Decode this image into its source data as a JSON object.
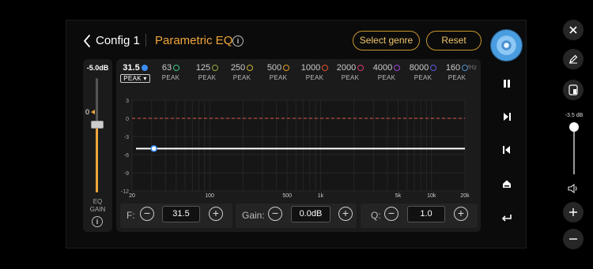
{
  "header": {
    "config_label": "Config 1",
    "title": "Parametric EQ",
    "info": "i",
    "select_genre_label": "Select genre",
    "reset_label": "Reset"
  },
  "eq_gain": {
    "value": "-5.0dB",
    "slider_marker": "0",
    "label_line1": "EQ",
    "label_line2": "GAIN",
    "info": "i"
  },
  "bands": [
    {
      "freq": "31.5",
      "type": "PEAK ▾",
      "color": "#3b8cf2",
      "active": true
    },
    {
      "freq": "63",
      "type": "PEAK",
      "color": "#3dc48a"
    },
    {
      "freq": "125",
      "type": "PEAK",
      "color": "#9aa83a"
    },
    {
      "freq": "250",
      "type": "PEAK",
      "color": "#c9b234"
    },
    {
      "freq": "500",
      "type": "PEAK",
      "color": "#e09a2b"
    },
    {
      "freq": "1000",
      "type": "PEAK",
      "color": "#e0552b"
    },
    {
      "freq": "2000",
      "type": "PEAK",
      "color": "#d63b6a"
    },
    {
      "freq": "4000",
      "type": "PEAK",
      "color": "#9a4ad6"
    },
    {
      "freq": "8000",
      "type": "PEAK",
      "color": "#5b5be0"
    },
    {
      "freq": "160",
      "type": "PEAK",
      "color": "#4a8fd0"
    }
  ],
  "hz_unit": "/Hz",
  "graph": {
    "y_ticks": [
      "3",
      "0",
      "-3",
      "-6",
      "-9",
      "-12"
    ],
    "x_ticks": [
      "20",
      "100",
      "500",
      "1k",
      "5k",
      "10k",
      "20k"
    ],
    "curve_gain_db": -5.0,
    "reference_line_db": 0,
    "control_point": {
      "freq": 31.5,
      "gain_db": -5.0
    }
  },
  "controls": {
    "f_label": "F:",
    "f_value": "31.5",
    "gain_label": "Gain:",
    "gain_value": "0.0dB",
    "q_label": "Q:",
    "q_value": "1.0",
    "minus": "−",
    "plus": "+"
  },
  "system": {
    "volume_label": "-3.5 dB",
    "volume_level": 0.0
  },
  "colors": {
    "accent": "#f0a63a",
    "active_band": "#3b8cf2",
    "reference_line": "#e05a4a"
  },
  "icons": {
    "back": "chevron-left-icon",
    "disc": "disc-icon",
    "pause": "pause-icon",
    "next": "skip-next-icon",
    "previous": "skip-previous-icon",
    "home": "home-icon",
    "return": "return-icon",
    "close": "close-icon",
    "edit": "pencil-icon",
    "screenshot": "screenshot-icon",
    "volume": "volume-icon",
    "plus": "plus-icon",
    "minus": "minus-icon"
  }
}
